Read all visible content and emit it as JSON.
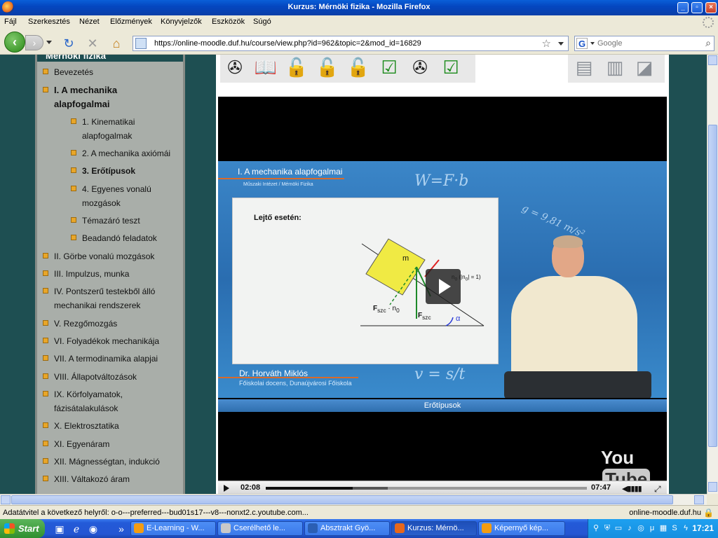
{
  "window": {
    "title": "Kurzus: Mérnöki fizika - Mozilla Firefox"
  },
  "menu": [
    "Fájl",
    "Szerkesztés",
    "Nézet",
    "Előzmények",
    "Könyvjelzők",
    "Eszközök",
    "Súgó"
  ],
  "nav": {
    "url": "https://online-moodle.duf.hu/course/view.php?id=962&topic=2&mod_id=16829",
    "search_placeholder": "Google"
  },
  "sidebar": {
    "header": "Mérnöki fizika",
    "items": [
      {
        "label": "Bevezetés"
      },
      {
        "label": "I. A mechanika alapfogalmai"
      },
      {
        "label": "1. Kinematikai alapfogalmak"
      },
      {
        "label": "2. A mechanika axiómái"
      },
      {
        "label": "3. Erőtípusok"
      },
      {
        "label": "4. Egyenes vonalú mozgások"
      },
      {
        "label": "Témazáró teszt"
      },
      {
        "label": "Beadandó feladatok"
      },
      {
        "label": "II. Görbe vonalú mozgások"
      },
      {
        "label": "III. Impulzus, munka"
      },
      {
        "label": "IV. Pontszerű testekből álló mechanikai rendszerek"
      },
      {
        "label": "V. Rezgőmozgás"
      },
      {
        "label": "VI. Folyadékok mechanikája"
      },
      {
        "label": "VII. A termodinamika alapjai"
      },
      {
        "label": "VIII. Állapotváltozások"
      },
      {
        "label": "IX. Körfolyamatok, fázisátalakulások"
      },
      {
        "label": "X. Elektrosztatika"
      },
      {
        "label": "XI. Egyenáram"
      },
      {
        "label": "XII. Mágnesség­tan, indukció"
      },
      {
        "label": "XIII. Váltakozó áram"
      }
    ]
  },
  "video": {
    "slide_title": "I. A mechanika alapfogalmai",
    "slide_subtitle": "Műszaki Intézet / Mérnöki Fizika",
    "board_title": "Lejtő esetén:",
    "mass_label": "m",
    "force_label_left": "F",
    "force_label_left_sub": "szc",
    "force_label_left_rest": "· n",
    "force_label_left_rest_sub": "0",
    "force_label_right": "F",
    "force_label_right_sub": "szc",
    "normal_label": "n",
    "normal_label_sub": "0",
    "normal_label_rest": "(|n",
    "normal_label_rest_sub": "0",
    "normal_label_end": "| = 1)",
    "angle_label": "α",
    "chalk_1": "W=F·b",
    "chalk_2": "g = 9,81 m/s²",
    "chalk_3": "v = s/t",
    "presenter_name": "Dr. Horváth Miklós",
    "presenter_role": "Főiskolai docens, Dunaújvárosi Főiskola",
    "caption": "Erőtípusok",
    "time_current": "02:08",
    "time_total": "07:47",
    "progress": 0.27,
    "loaded": 0.38,
    "logo_you": "You",
    "logo_tube": "Tube"
  },
  "status": {
    "message": "Adatátvitel a következő helyről: o-o---preferred---bud01s17---v8---nonxt2.c.youtube.com...",
    "host": "online-moodle.duf.hu"
  },
  "taskbar": {
    "start": "Start",
    "tasks": [
      {
        "label": "E-Learning - W..."
      },
      {
        "label": "Cserélhető le..."
      },
      {
        "label": "Absztrakt Gyö..."
      },
      {
        "label": "Kurzus: Mérnö..."
      },
      {
        "label": "Képernyő kép..."
      }
    ],
    "clock": "17:21"
  },
  "colors": {
    "accent": "#1e4f52",
    "sidebar_bg": "#a9aea9",
    "bullet": "#e8a629"
  }
}
